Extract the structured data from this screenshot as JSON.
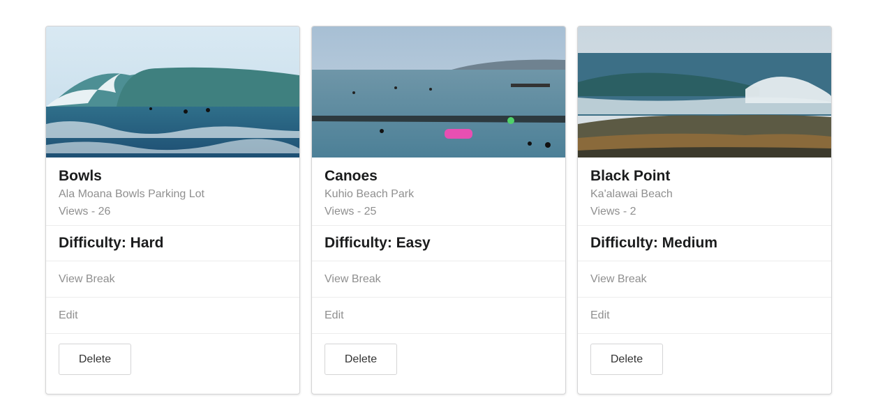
{
  "cards": [
    {
      "title": "Bowls",
      "location": "Ala Moana Bowls Parking Lot",
      "views": "Views - 26",
      "difficulty": "Difficulty: Hard",
      "view_link": "View Break",
      "edit_link": "Edit",
      "delete_label": "Delete"
    },
    {
      "title": "Canoes",
      "location": "Kuhio Beach Park",
      "views": "Views - 25",
      "difficulty": "Difficulty: Easy",
      "view_link": "View Break",
      "edit_link": "Edit",
      "delete_label": "Delete"
    },
    {
      "title": "Black Point",
      "location": "Ka'alawai Beach",
      "views": "Views - 2",
      "difficulty": "Difficulty: Medium",
      "view_link": "View Break",
      "edit_link": "Edit",
      "delete_label": "Delete"
    }
  ]
}
